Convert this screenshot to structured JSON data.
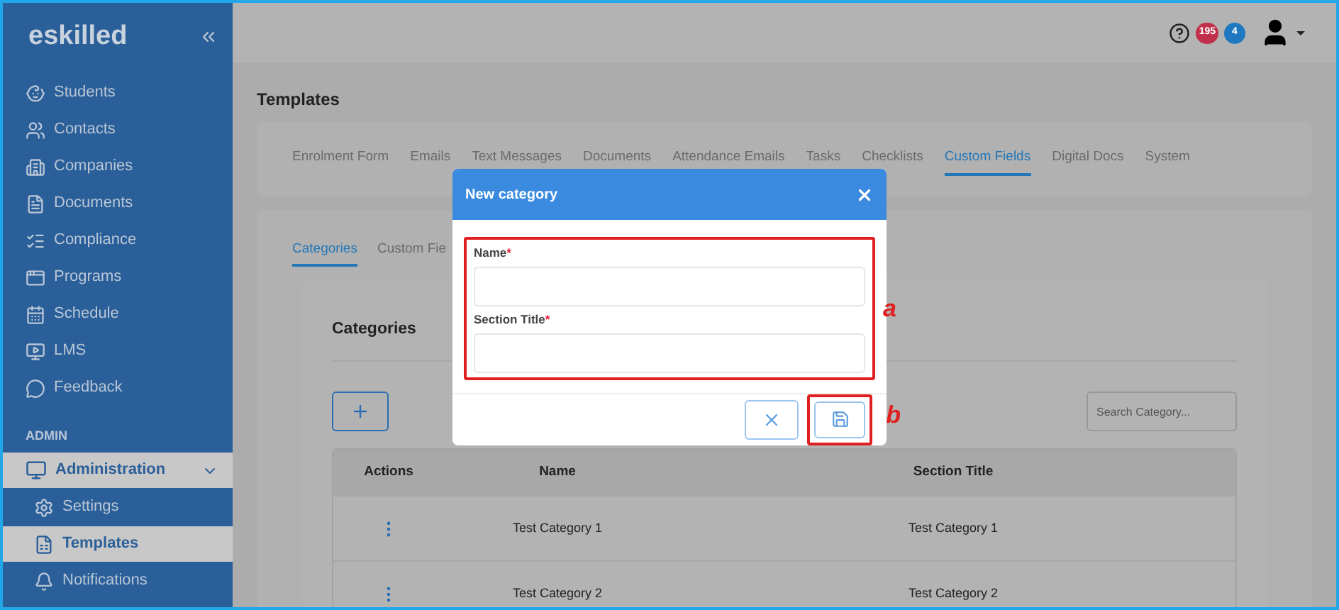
{
  "sidebar": {
    "logo": "eskilled",
    "items": [
      {
        "label": "Students"
      },
      {
        "label": "Contacts"
      },
      {
        "label": "Companies"
      },
      {
        "label": "Documents"
      },
      {
        "label": "Compliance"
      },
      {
        "label": "Programs"
      },
      {
        "label": "Schedule"
      },
      {
        "label": "LMS"
      },
      {
        "label": "Feedback"
      }
    ],
    "section": "ADMIN",
    "group": {
      "label": "Administration",
      "expanded": true,
      "selected": true,
      "children": [
        {
          "label": "Settings",
          "selected": false
        },
        {
          "label": "Templates",
          "selected": true
        },
        {
          "label": "Notifications",
          "selected": false
        }
      ]
    }
  },
  "topbar": {
    "badges": [
      {
        "text": "195",
        "color": "#c0304a"
      },
      {
        "text": "4",
        "color": "#1f78c0"
      }
    ]
  },
  "page_title": "Templates",
  "tabs": [
    {
      "label": "Enrolment Form",
      "selected": false
    },
    {
      "label": "Emails",
      "selected": false
    },
    {
      "label": "Text Messages",
      "selected": false
    },
    {
      "label": "Documents",
      "selected": false
    },
    {
      "label": "Attendance Emails",
      "selected": false
    },
    {
      "label": "Tasks",
      "selected": false
    },
    {
      "label": "Checklists",
      "selected": false
    },
    {
      "label": "Custom Fields",
      "selected": true
    },
    {
      "label": "Digital Docs",
      "selected": false
    },
    {
      "label": "System",
      "selected": false
    }
  ],
  "subtabs": [
    {
      "label": "Categories",
      "selected": true
    },
    {
      "label": "Custom Fie",
      "selected": false
    }
  ],
  "card_title": "Categories",
  "search": {
    "placeholder": "Search Category..."
  },
  "table": {
    "columns": [
      "Actions",
      "Name",
      "Section Title"
    ],
    "rows": [
      {
        "name": "Test Category 1",
        "section_title": "Test Category 1"
      },
      {
        "name": "Test Category 2",
        "section_title": "Test Category 2"
      }
    ]
  },
  "modal": {
    "title": "New category",
    "required_mark": "*",
    "fields": [
      {
        "label": "Name",
        "required": true
      },
      {
        "label": "Section Title",
        "required": true
      }
    ]
  },
  "annotations": [
    "a",
    "b"
  ]
}
